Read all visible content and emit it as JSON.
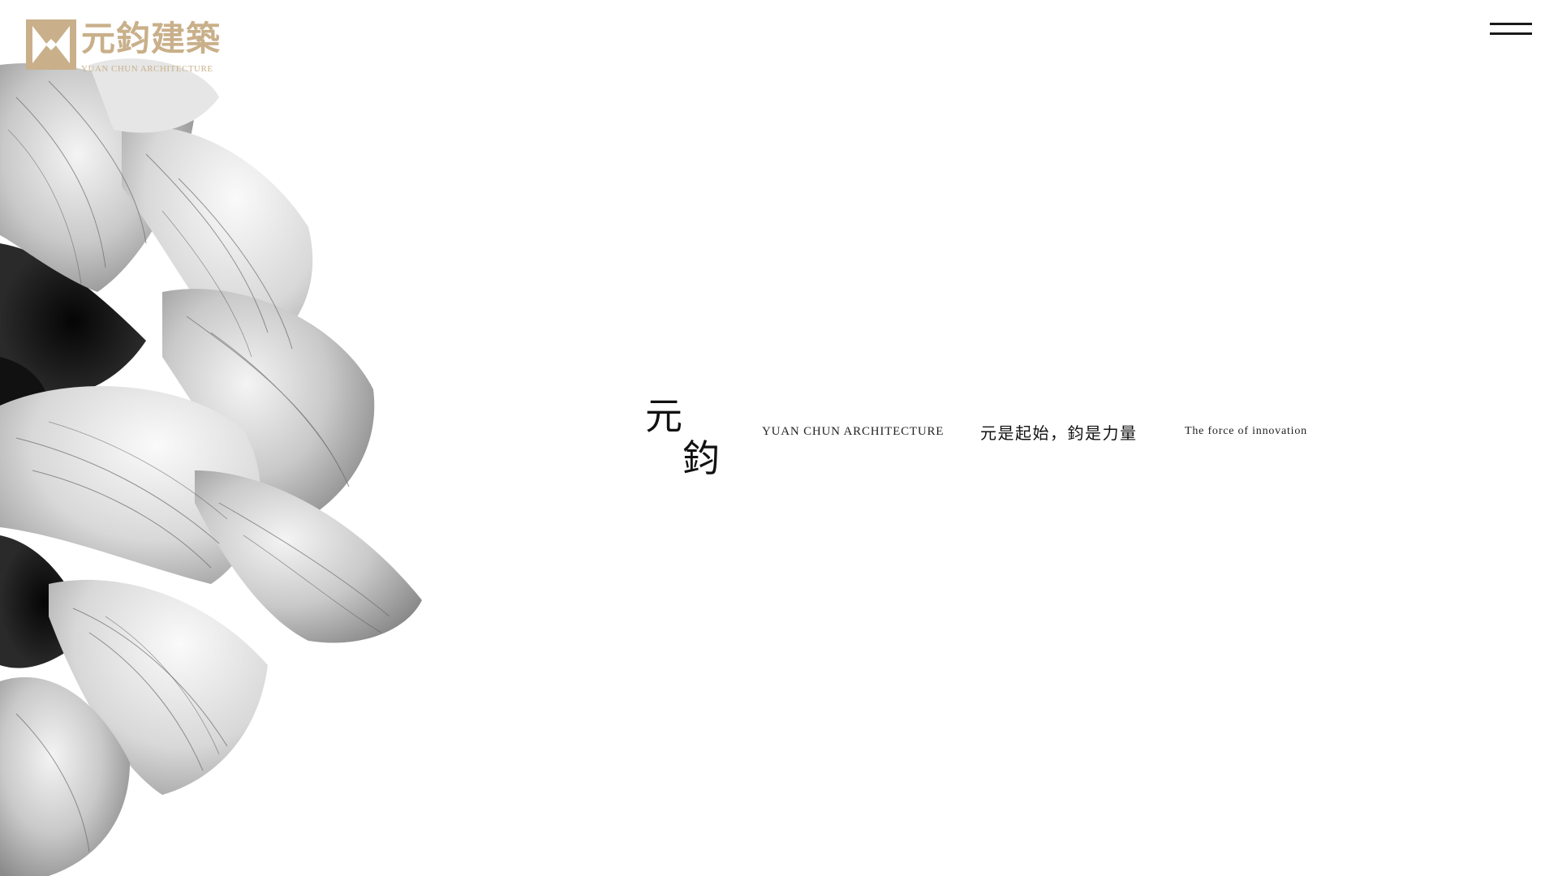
{
  "logo": {
    "name_cn": "元鈞建築",
    "name_en": "YUAN CHUN ARCHITECTURE",
    "mark_icon": "yc-monogram-icon"
  },
  "menu": {
    "icon": "hamburger-menu-icon"
  },
  "hero": {
    "image_icon": "crumpled-flower-petals-image"
  },
  "tagline": {
    "brand_char_1": "元",
    "brand_char_2": "鈞",
    "english_name": "YUAN CHUN ARCHITECTURE",
    "chinese_motto": "元是起始，鈞是力量",
    "english_motto": "The force of innovation"
  },
  "colors": {
    "background": "#ffffff",
    "logo_gold": "#c9b08a",
    "text_dark": "#111111"
  }
}
